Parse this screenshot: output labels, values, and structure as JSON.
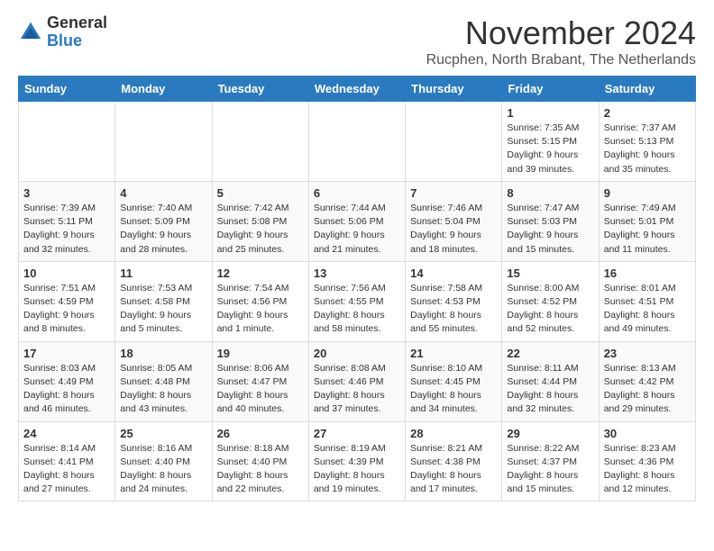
{
  "logo": {
    "general": "General",
    "blue": "Blue"
  },
  "title": "November 2024",
  "location": "Rucphen, North Brabant, The Netherlands",
  "days_of_week": [
    "Sunday",
    "Monday",
    "Tuesday",
    "Wednesday",
    "Thursday",
    "Friday",
    "Saturday"
  ],
  "weeks": [
    [
      {
        "day": "",
        "info": ""
      },
      {
        "day": "",
        "info": ""
      },
      {
        "day": "",
        "info": ""
      },
      {
        "day": "",
        "info": ""
      },
      {
        "day": "",
        "info": ""
      },
      {
        "day": "1",
        "info": "Sunrise: 7:35 AM\nSunset: 5:15 PM\nDaylight: 9 hours and 39 minutes."
      },
      {
        "day": "2",
        "info": "Sunrise: 7:37 AM\nSunset: 5:13 PM\nDaylight: 9 hours and 35 minutes."
      }
    ],
    [
      {
        "day": "3",
        "info": "Sunrise: 7:39 AM\nSunset: 5:11 PM\nDaylight: 9 hours and 32 minutes."
      },
      {
        "day": "4",
        "info": "Sunrise: 7:40 AM\nSunset: 5:09 PM\nDaylight: 9 hours and 28 minutes."
      },
      {
        "day": "5",
        "info": "Sunrise: 7:42 AM\nSunset: 5:08 PM\nDaylight: 9 hours and 25 minutes."
      },
      {
        "day": "6",
        "info": "Sunrise: 7:44 AM\nSunset: 5:06 PM\nDaylight: 9 hours and 21 minutes."
      },
      {
        "day": "7",
        "info": "Sunrise: 7:46 AM\nSunset: 5:04 PM\nDaylight: 9 hours and 18 minutes."
      },
      {
        "day": "8",
        "info": "Sunrise: 7:47 AM\nSunset: 5:03 PM\nDaylight: 9 hours and 15 minutes."
      },
      {
        "day": "9",
        "info": "Sunrise: 7:49 AM\nSunset: 5:01 PM\nDaylight: 9 hours and 11 minutes."
      }
    ],
    [
      {
        "day": "10",
        "info": "Sunrise: 7:51 AM\nSunset: 4:59 PM\nDaylight: 9 hours and 8 minutes."
      },
      {
        "day": "11",
        "info": "Sunrise: 7:53 AM\nSunset: 4:58 PM\nDaylight: 9 hours and 5 minutes."
      },
      {
        "day": "12",
        "info": "Sunrise: 7:54 AM\nSunset: 4:56 PM\nDaylight: 9 hours and 1 minute."
      },
      {
        "day": "13",
        "info": "Sunrise: 7:56 AM\nSunset: 4:55 PM\nDaylight: 8 hours and 58 minutes."
      },
      {
        "day": "14",
        "info": "Sunrise: 7:58 AM\nSunset: 4:53 PM\nDaylight: 8 hours and 55 minutes."
      },
      {
        "day": "15",
        "info": "Sunrise: 8:00 AM\nSunset: 4:52 PM\nDaylight: 8 hours and 52 minutes."
      },
      {
        "day": "16",
        "info": "Sunrise: 8:01 AM\nSunset: 4:51 PM\nDaylight: 8 hours and 49 minutes."
      }
    ],
    [
      {
        "day": "17",
        "info": "Sunrise: 8:03 AM\nSunset: 4:49 PM\nDaylight: 8 hours and 46 minutes."
      },
      {
        "day": "18",
        "info": "Sunrise: 8:05 AM\nSunset: 4:48 PM\nDaylight: 8 hours and 43 minutes."
      },
      {
        "day": "19",
        "info": "Sunrise: 8:06 AM\nSunset: 4:47 PM\nDaylight: 8 hours and 40 minutes."
      },
      {
        "day": "20",
        "info": "Sunrise: 8:08 AM\nSunset: 4:46 PM\nDaylight: 8 hours and 37 minutes."
      },
      {
        "day": "21",
        "info": "Sunrise: 8:10 AM\nSunset: 4:45 PM\nDaylight: 8 hours and 34 minutes."
      },
      {
        "day": "22",
        "info": "Sunrise: 8:11 AM\nSunset: 4:44 PM\nDaylight: 8 hours and 32 minutes."
      },
      {
        "day": "23",
        "info": "Sunrise: 8:13 AM\nSunset: 4:42 PM\nDaylight: 8 hours and 29 minutes."
      }
    ],
    [
      {
        "day": "24",
        "info": "Sunrise: 8:14 AM\nSunset: 4:41 PM\nDaylight: 8 hours and 27 minutes."
      },
      {
        "day": "25",
        "info": "Sunrise: 8:16 AM\nSunset: 4:40 PM\nDaylight: 8 hours and 24 minutes."
      },
      {
        "day": "26",
        "info": "Sunrise: 8:18 AM\nSunset: 4:40 PM\nDaylight: 8 hours and 22 minutes."
      },
      {
        "day": "27",
        "info": "Sunrise: 8:19 AM\nSunset: 4:39 PM\nDaylight: 8 hours and 19 minutes."
      },
      {
        "day": "28",
        "info": "Sunrise: 8:21 AM\nSunset: 4:38 PM\nDaylight: 8 hours and 17 minutes."
      },
      {
        "day": "29",
        "info": "Sunrise: 8:22 AM\nSunset: 4:37 PM\nDaylight: 8 hours and 15 minutes."
      },
      {
        "day": "30",
        "info": "Sunrise: 8:23 AM\nSunset: 4:36 PM\nDaylight: 8 hours and 12 minutes."
      }
    ]
  ]
}
